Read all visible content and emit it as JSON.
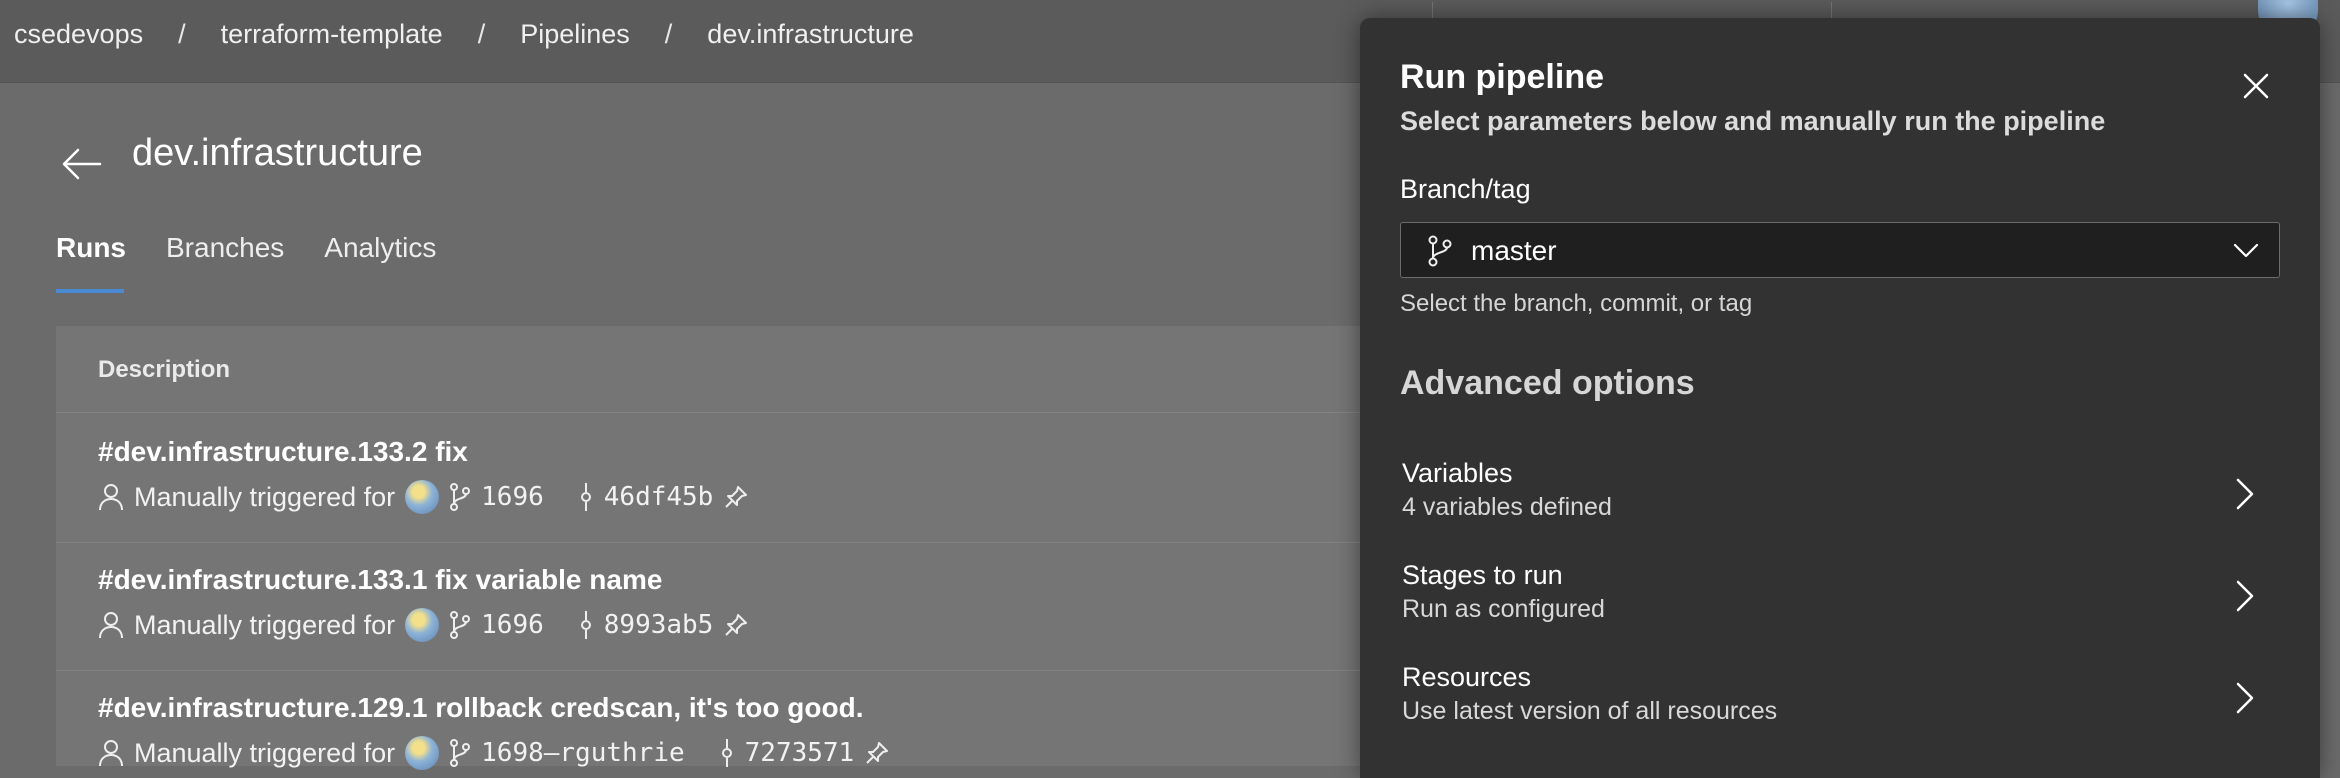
{
  "breadcrumb": {
    "items": [
      "csedevops",
      "terraform-template",
      "Pipelines",
      "dev.infrastructure"
    ],
    "separator": "/"
  },
  "page": {
    "title": "dev.infrastructure",
    "tabs": [
      {
        "label": "Runs",
        "active": true
      },
      {
        "label": "Branches",
        "active": false
      },
      {
        "label": "Analytics",
        "active": false
      }
    ]
  },
  "runs": {
    "header": "Description",
    "items": [
      {
        "title": "#dev.infrastructure.133.2 fix",
        "trigger": "Manually triggered for",
        "branch": "1696",
        "commit": "46df45b"
      },
      {
        "title": "#dev.infrastructure.133.1 fix variable name",
        "trigger": "Manually triggered for",
        "branch": "1696",
        "commit": "8993ab5"
      },
      {
        "title": "#dev.infrastructure.129.1 rollback credscan, it's too good.",
        "trigger": "Manually triggered for",
        "branch": "1698–rguthrie",
        "commit": "7273571"
      }
    ]
  },
  "panel": {
    "title": "Run pipeline",
    "subtitle": "Select parameters below and manually run the pipeline",
    "branch_label": "Branch/tag",
    "branch_value": "master",
    "branch_help": "Select the branch, commit, or tag",
    "advanced_title": "Advanced options",
    "options": [
      {
        "label": "Variables",
        "description": "4 variables defined"
      },
      {
        "label": "Stages to run",
        "description": "Run as configured"
      },
      {
        "label": "Resources",
        "description": "Use latest version of all resources"
      }
    ]
  },
  "colors": {
    "background": "#6b6b6b",
    "panel": "#323232",
    "accent": "#4a8ad4"
  }
}
